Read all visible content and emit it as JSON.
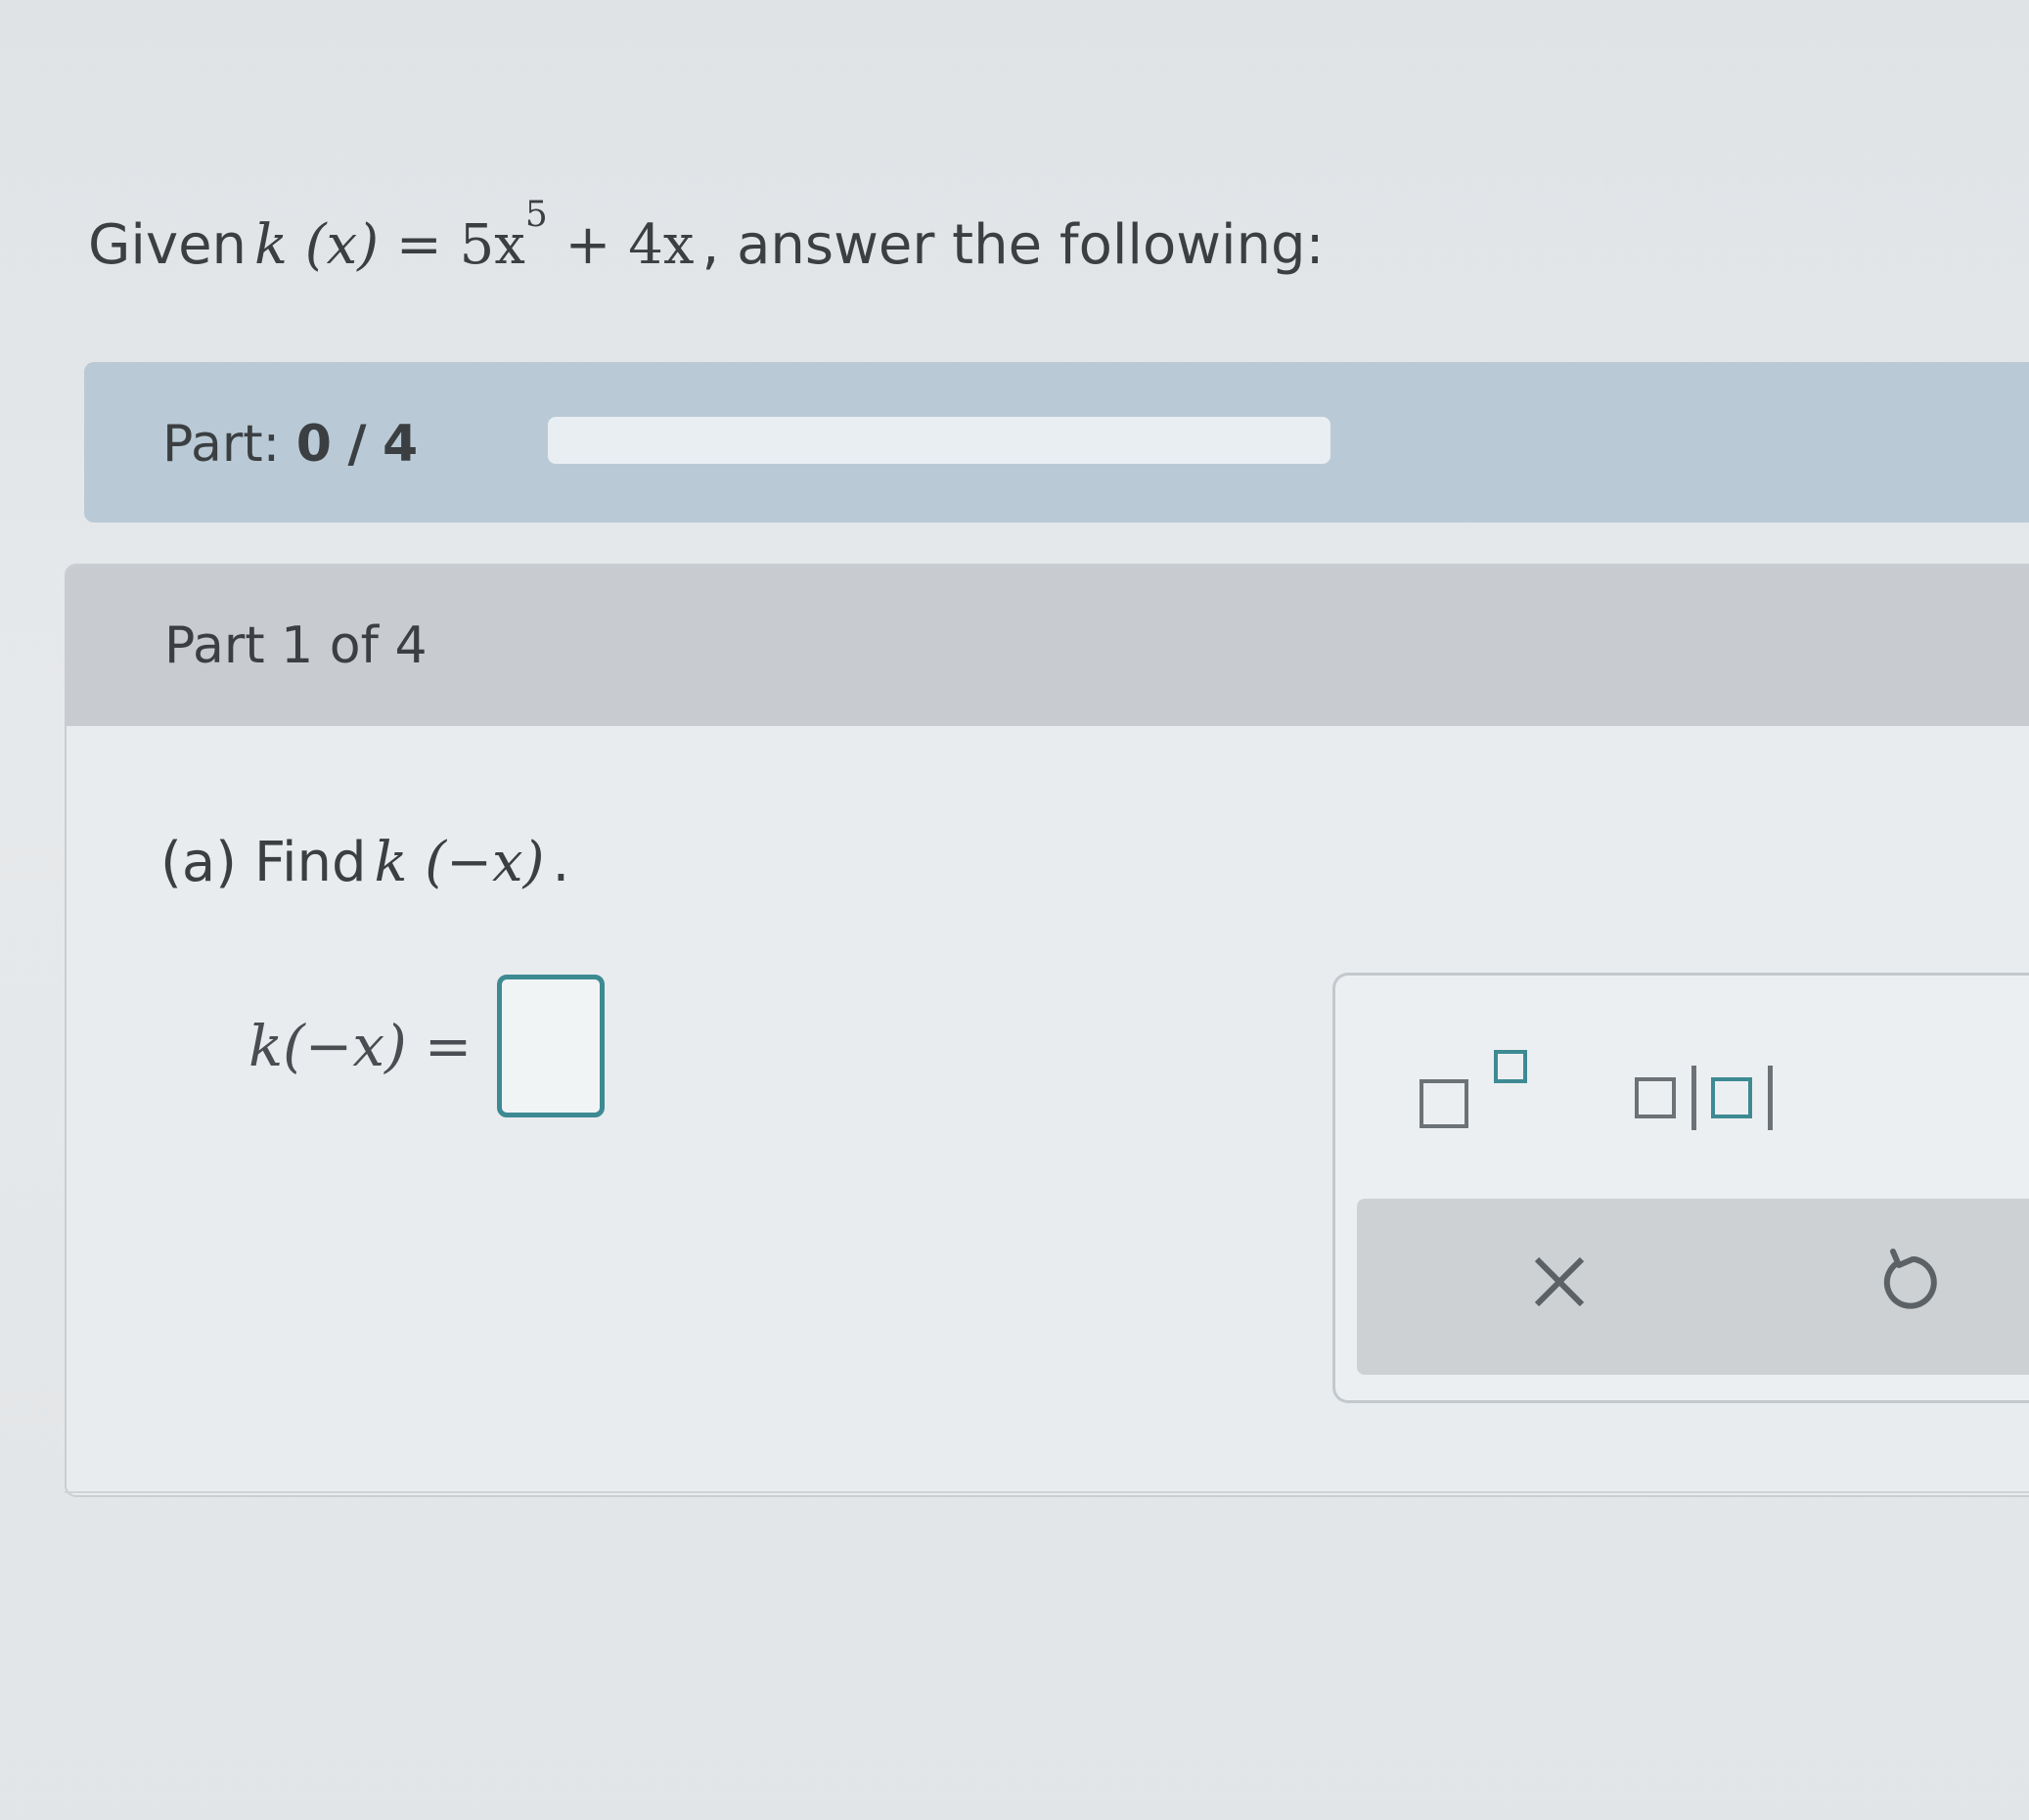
{
  "problem": {
    "given_label": "Given",
    "function_lhs": "k (x)",
    "equals": "=",
    "term1": "5x",
    "exponent": "5",
    "term2": "+ 4x",
    "suffix": ", answer the following:"
  },
  "progress": {
    "label": "Part:",
    "current": "0",
    "separator": "/",
    "total": "4",
    "fraction_complete": 0
  },
  "part": {
    "header": "Part 1 of 4",
    "question_prefix": "(a) Find",
    "question_math": "k (−x)",
    "question_suffix": ".",
    "answer_lhs": "k(−x)",
    "answer_equals": "=",
    "answer_value": ""
  },
  "toolbar": {
    "superscript_icon": "superscript-template-icon",
    "absolute_value_icon": "absolute-value-template-icon",
    "clear_icon": "close-icon",
    "undo_icon": "undo-icon"
  },
  "colors": {
    "accent": "#3d8a93",
    "progress_bar_bg": "#b9cad6",
    "part_header_bg": "#c8ccd0"
  }
}
